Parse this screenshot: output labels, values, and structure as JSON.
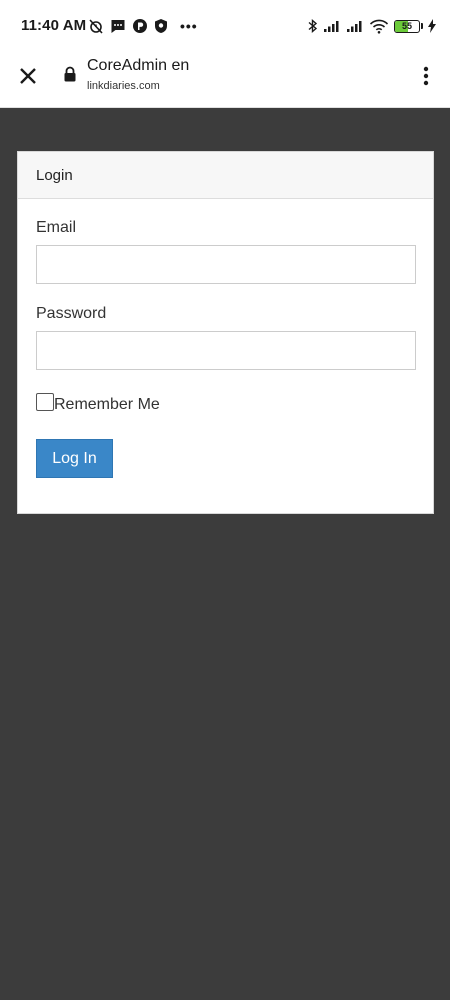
{
  "status_bar": {
    "time": "11:40 AM",
    "left_icons": [
      "alarm-off-icon",
      "message-icon",
      "p-badge-icon",
      "shield-icon"
    ],
    "more": "•••",
    "right_icons": [
      "bluetooth-icon",
      "signal-icon",
      "signal-icon",
      "wifi-icon"
    ],
    "battery_level": "55",
    "battery_fraction": 0.55,
    "battery_color": "#6ccb3a"
  },
  "browser": {
    "title": "CoreAdmin en",
    "url": "linkdiaries.com"
  },
  "login_card": {
    "header": "Login",
    "email_label": "Email",
    "email_value": "",
    "password_label": "Password",
    "password_value": "",
    "remember_label": "Remember Me",
    "remember_checked": false,
    "submit_label": "Log In",
    "accent_color": "#3a87c8"
  },
  "colors": {
    "page_background": "#3c3c3c"
  }
}
